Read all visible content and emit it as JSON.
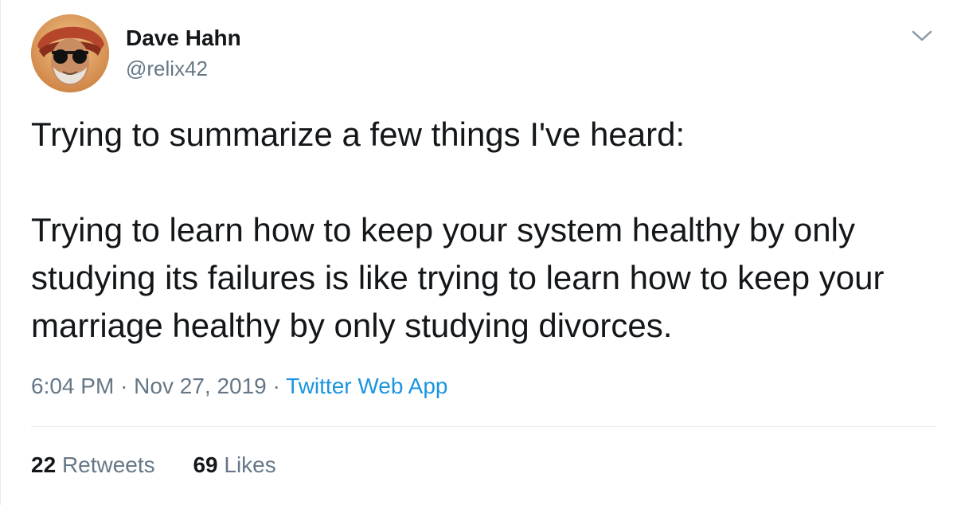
{
  "user": {
    "display_name": "Dave Hahn",
    "handle": "@relix42",
    "avatar_icon": "user-avatar-photo"
  },
  "menu": {
    "icon": "chevron-down-icon"
  },
  "tweet": {
    "paragraphs": [
      "Trying to summarize a few things I've heard:",
      "Trying to learn how to keep your system healthy by only studying its failures is like trying to learn how to keep your marriage healthy by only studying divorces."
    ],
    "time": "6:04 PM",
    "date": "Nov 27, 2019",
    "separator": "·",
    "source": "Twitter Web App"
  },
  "stats": {
    "retweets_count": "22",
    "retweets_label": "Retweets",
    "likes_count": "69",
    "likes_label": "Likes"
  },
  "colors": {
    "text": "#14171a",
    "secondary": "#657786",
    "link": "#1b95e0",
    "border": "#e6ecf0"
  }
}
